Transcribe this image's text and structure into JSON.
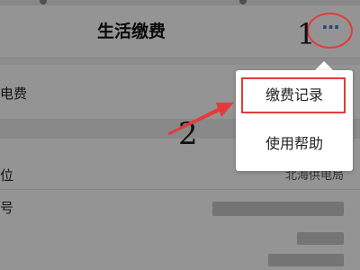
{
  "header": {
    "title": "生活缴费",
    "more_glyph": "···"
  },
  "list": {
    "row1_label": "电费",
    "row2_label": "位",
    "row2_value": "北海供电局",
    "row3_label": "号"
  },
  "popup": {
    "items": [
      {
        "label": "缴费记录"
      },
      {
        "label": "使用帮助"
      }
    ]
  },
  "annotations": {
    "step1": "1",
    "step2": "2"
  },
  "colors": {
    "highlight": "#e33b3b",
    "accent": "#3f7fcf",
    "overlay": "rgba(0,0,0,0.42)"
  },
  "icons": {
    "more": "more-dots-icon",
    "arrow": "annotation-arrow-icon"
  }
}
